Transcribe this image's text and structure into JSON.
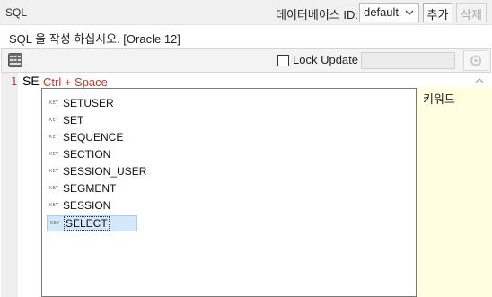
{
  "header": {
    "title": "SQL",
    "db_label": "데이터베이스 ID:",
    "db_value": "default",
    "add_label": "추가",
    "delete_label": "삭제"
  },
  "instruction": "SQL 을 작성 하십시오. [Oracle 12]",
  "toolbar": {
    "format_icon": "sql-format-icon",
    "lock_label": "Lock Update",
    "lock_checked": false,
    "right_icon": "settings-icon"
  },
  "editor": {
    "line_number": "1",
    "code": "SE",
    "hint": "Ctrl + Space"
  },
  "autocomplete": {
    "kind_label": "KEY",
    "items": [
      "SETUSER",
      "SET",
      "SEQUENCE",
      "SECTION",
      "SESSION_USER",
      "SEGMENT",
      "SESSION",
      "SELECT"
    ],
    "selected": "SELECT",
    "description": "키워드"
  },
  "colors": {
    "hint": "#c0392b",
    "selection": "#d5e8fb",
    "description_bg": "#fffee1"
  }
}
